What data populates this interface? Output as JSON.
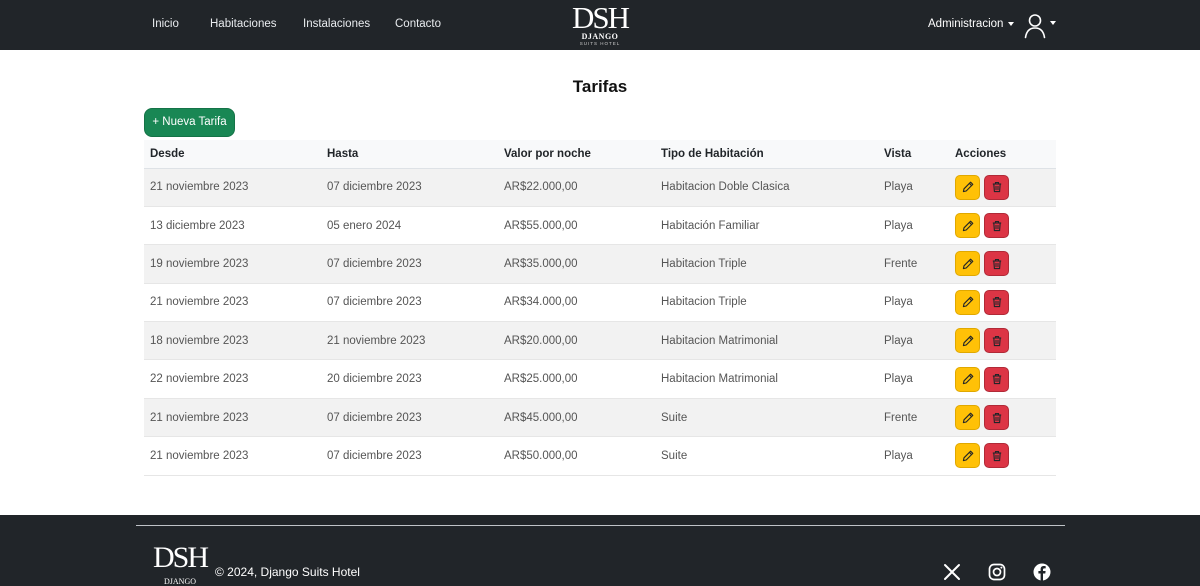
{
  "navbar": {
    "links": [
      "Inicio",
      "Habitaciones",
      "Instalaciones",
      "Contacto"
    ],
    "brand": {
      "mark": "DSH",
      "sub": "DJANGO",
      "sub2": "SUITS HOTEL"
    },
    "admin_label": "Administracion",
    "user_icon": "person-icon"
  },
  "page": {
    "title": "Tarifas",
    "new_button": "+ Nueva Tarifa"
  },
  "table": {
    "headers": [
      "Desde",
      "Hasta",
      "Valor por noche",
      "Tipo de Habitación",
      "Vista",
      "Acciones"
    ],
    "rows": [
      [
        "21 noviembre 2023",
        "07 diciembre 2023",
        "AR$22.000,00",
        "Habitacion Doble Clasica",
        "Playa"
      ],
      [
        "13 diciembre 2023",
        "05 enero 2024",
        "AR$55.000,00",
        "Habitación Familiar",
        "Playa"
      ],
      [
        "19 noviembre 2023",
        "07 diciembre 2023",
        "AR$35.000,00",
        "Habitacion Triple",
        "Frente"
      ],
      [
        "21 noviembre 2023",
        "07 diciembre 2023",
        "AR$34.000,00",
        "Habitacion Triple",
        "Playa"
      ],
      [
        "18 noviembre 2023",
        "21 noviembre 2023",
        "AR$20.000,00",
        "Habitacion Matrimonial",
        "Playa"
      ],
      [
        "22 noviembre 2023",
        "20 diciembre 2023",
        "AR$25.000,00",
        "Habitacion Matrimonial",
        "Playa"
      ],
      [
        "21 noviembre 2023",
        "07 diciembre 2023",
        "AR$45.000,00",
        "Suite",
        "Frente"
      ],
      [
        "21 noviembre 2023",
        "07 diciembre 2023",
        "AR$50.000,00",
        "Suite",
        "Playa"
      ]
    ],
    "action_icons": {
      "edit": "pencil-icon",
      "delete": "trash-icon"
    }
  },
  "footer": {
    "logo_mark": "DSH",
    "logo_sub": "DJANGO",
    "copyright": "© 2024, Django Suits Hotel",
    "social_icons": [
      "x-icon",
      "instagram-icon",
      "facebook-icon"
    ]
  },
  "colors": {
    "navbar_bg": "#212529",
    "success": "#198754",
    "warning": "#ffc107",
    "danger": "#dc3545"
  }
}
